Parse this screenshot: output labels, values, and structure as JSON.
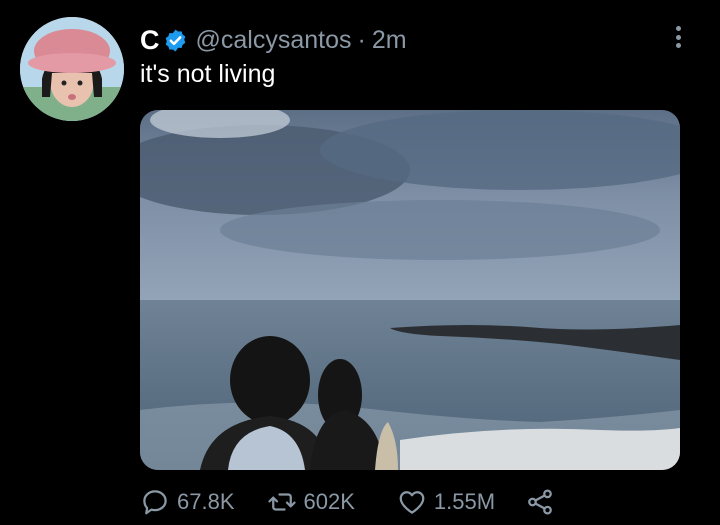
{
  "tweet": {
    "display_name": "C",
    "handle": "@calcysantos",
    "separator": "·",
    "time": "2m",
    "text": "it's not living",
    "verified": true
  },
  "actions": {
    "replies": "67.8K",
    "retweets": "602K",
    "likes": "1.55M"
  },
  "icons": {
    "verified": "verified-badge-icon",
    "more": "more-options-icon",
    "reply": "reply-icon",
    "retweet": "retweet-icon",
    "like": "like-icon",
    "share": "share-icon"
  },
  "colors": {
    "background": "#000000",
    "text": "#ffffff",
    "muted": "#8b98a5",
    "verified": "#1d9bf0"
  }
}
